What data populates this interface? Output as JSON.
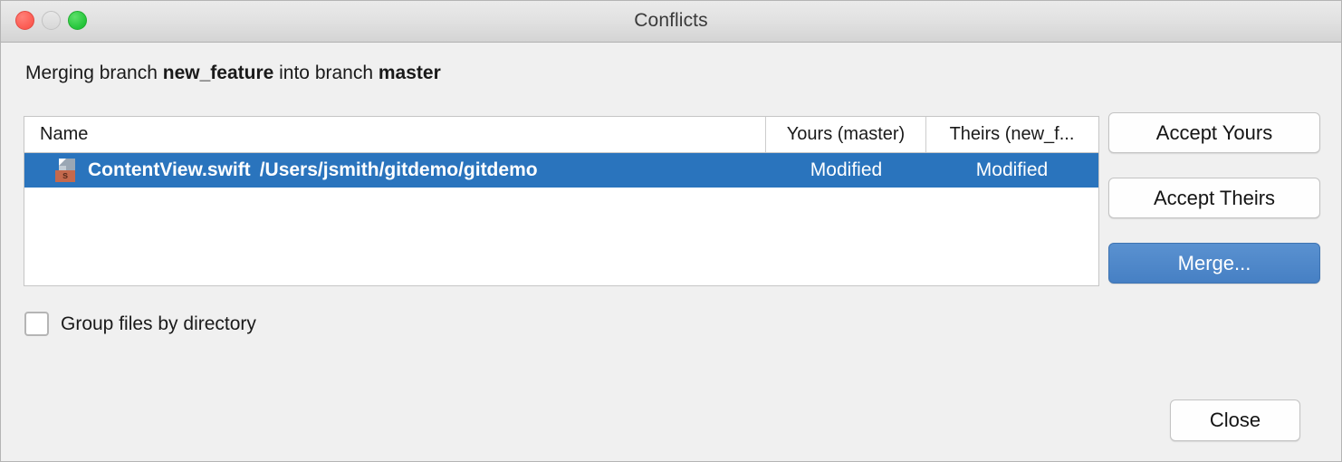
{
  "window": {
    "title": "Conflicts",
    "traffic_lights": [
      "close",
      "minimize",
      "maximize"
    ]
  },
  "merge_info": {
    "prefix": "Merging branch ",
    "source_branch": "new_feature",
    "middle": " into branch ",
    "target_branch": "master"
  },
  "table": {
    "columns": [
      {
        "key": "name",
        "label": "Name"
      },
      {
        "key": "yours",
        "label": "Yours (master)"
      },
      {
        "key": "theirs",
        "label": "Theirs (new_f..."
      }
    ],
    "rows": [
      {
        "icon": "swift-file-icon",
        "icon_badge": "s",
        "name": "ContentView.swift",
        "path": "/Users/jsmith/gitdemo/gitdemo",
        "yours": "Modified",
        "theirs": "Modified",
        "selected": true
      }
    ]
  },
  "actions": {
    "accept_yours": "Accept Yours",
    "accept_theirs": "Accept Theirs",
    "merge": "Merge...",
    "close": "Close"
  },
  "options": {
    "group_by_directory_label": "Group files by directory",
    "group_by_directory_checked": false
  },
  "colors": {
    "selection_blue": "#2a74bd",
    "default_button_blue": "#4d88ca",
    "window_background": "#f0f0f0",
    "titlebar_top": "#eaeaea",
    "titlebar_bottom": "#d4d4d4",
    "swift_badge": "#c4694d"
  }
}
